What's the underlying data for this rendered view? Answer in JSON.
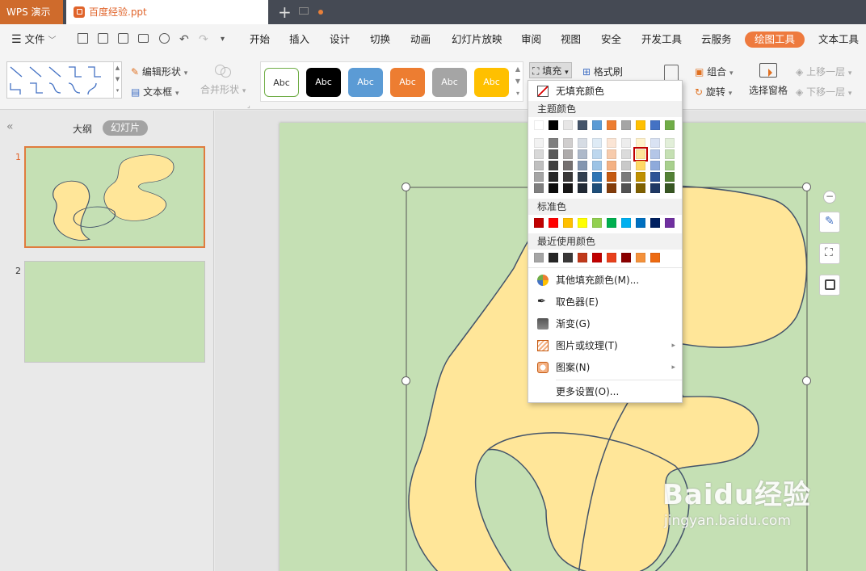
{
  "titlebar": {
    "app_name": "WPS 演示",
    "file_name": "百度经验.ppt"
  },
  "menubar": {
    "file_label": "文件",
    "tabs": [
      "开始",
      "插入",
      "设计",
      "切换",
      "动画",
      "幻灯片放映",
      "审阅",
      "视图",
      "安全",
      "开发工具",
      "云服务",
      "绘图工具",
      "文本工具"
    ],
    "active_tab": "绘图工具"
  },
  "ribbon": {
    "edit_shape": "编辑形状",
    "text_box": "文本框",
    "merge_shape": "合并形状",
    "style_samples": [
      "Abc",
      "Abc",
      "Abc",
      "Abc",
      "Abc",
      "Abc"
    ],
    "fill": "填充",
    "format_painter": "格式刷",
    "group": "组合",
    "rotate": "旋转",
    "selection_pane": "选择窗格",
    "bring_forward": "上移一层",
    "send_backward": "下移一层"
  },
  "leftpanel": {
    "outline_tab": "大纲",
    "slides_tab": "幻灯片",
    "slide_numbers": [
      "1",
      "2"
    ]
  },
  "fill_menu": {
    "no_fill": "无填充颜色",
    "theme_colors_label": "主题颜色",
    "standard_colors_label": "标准色",
    "recent_colors_label": "最近使用颜色",
    "more_colors": "其他填充颜色(M)...",
    "eyedropper": "取色器(E)",
    "gradient": "渐变(G)",
    "picture_texture": "图片或纹理(T)",
    "pattern": "图案(N)",
    "more_settings": "更多设置(O)...",
    "theme_top": [
      "#ffffff",
      "#000000",
      "#e7e6e6",
      "#44546a",
      "#5b9bd5",
      "#ed7d31",
      "#a5a5a5",
      "#ffc000",
      "#4472c4",
      "#70ad47"
    ],
    "theme_shades": [
      [
        "#f2f2f2",
        "#7f7f7f",
        "#d0cece",
        "#d6dce4",
        "#deebf6",
        "#fbe5d5",
        "#ededed",
        "#fff2cc",
        "#d9e2f3",
        "#e2efd9"
      ],
      [
        "#d8d8d8",
        "#595959",
        "#aeabab",
        "#adb9ca",
        "#bdd7ee",
        "#f7cbac",
        "#dbdbdb",
        "#fee599",
        "#b4c6e7",
        "#c5e0b3"
      ],
      [
        "#bfbfbf",
        "#3f3f3f",
        "#757070",
        "#8496b0",
        "#9cc3e5",
        "#f4b183",
        "#c9c9c9",
        "#ffd965",
        "#8eaadb",
        "#a8d08d"
      ],
      [
        "#a5a5a5",
        "#262626",
        "#3a3838",
        "#323f4f",
        "#2e75b5",
        "#c55a11",
        "#7b7b7b",
        "#bf9000",
        "#2f5496",
        "#538135"
      ],
      [
        "#7f7f7f",
        "#0c0c0c",
        "#171616",
        "#222a35",
        "#1e4e79",
        "#833c0b",
        "#525252",
        "#7f6000",
        "#1f3864",
        "#375623"
      ]
    ],
    "selected_color": "#fee599",
    "standard_colors": [
      "#c00000",
      "#ff0000",
      "#ffc000",
      "#ffff00",
      "#92d050",
      "#00b050",
      "#00b0f0",
      "#0070c0",
      "#002060",
      "#7030a0"
    ],
    "recent_colors": [
      "#a5a5a5",
      "#262626",
      "#3a3838",
      "#c0391b",
      "#c00000",
      "#e8401c",
      "#8b0000",
      "#f4913b",
      "#ed6a11"
    ]
  },
  "watermark": {
    "brand": "Baidu经验",
    "url": "jingyan.baidu.com"
  }
}
